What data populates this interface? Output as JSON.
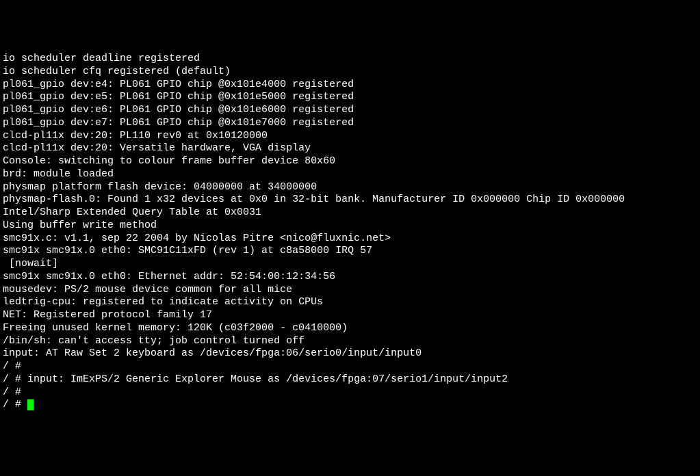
{
  "terminal": {
    "lines": [
      "io scheduler deadline registered",
      "io scheduler cfq registered (default)",
      "pl061_gpio dev:e4: PL061 GPIO chip @0x101e4000 registered",
      "pl061_gpio dev:e5: PL061 GPIO chip @0x101e5000 registered",
      "pl061_gpio dev:e6: PL061 GPIO chip @0x101e6000 registered",
      "pl061_gpio dev:e7: PL061 GPIO chip @0x101e7000 registered",
      "clcd-pl11x dev:20: PL110 rev0 at 0x10120000",
      "clcd-pl11x dev:20: Versatile hardware, VGA display",
      "Console: switching to colour frame buffer device 80x60",
      "brd: module loaded",
      "physmap platform flash device: 04000000 at 34000000",
      "physmap-flash.0: Found 1 x32 devices at 0x0 in 32-bit bank. Manufacturer ID 0x000000 Chip ID 0x000000",
      "Intel/Sharp Extended Query Table at 0x0031",
      "Using buffer write method",
      "smc91x.c: v1.1, sep 22 2004 by Nicolas Pitre <nico@fluxnic.net>",
      "smc91x smc91x.0 eth0: SMC91C11xFD (rev 1) at c8a58000 IRQ 57",
      " [nowait]",
      "smc91x smc91x.0 eth0: Ethernet addr: 52:54:00:12:34:56",
      "mousedev: PS/2 mouse device common for all mice",
      "ledtrig-cpu: registered to indicate activity on CPUs",
      "NET: Registered protocol family 17",
      "Freeing unused kernel memory: 120K (c03f2000 - c0410000)",
      "/bin/sh: can't access tty; job control turned off",
      "input: AT Raw Set 2 keyboard as /devices/fpga:06/serio0/input/input0",
      "/ #",
      "/ # input: ImExPS/2 Generic Explorer Mouse as /devices/fpga:07/serio1/input/input2",
      "",
      "/ #",
      "/ # "
    ]
  }
}
